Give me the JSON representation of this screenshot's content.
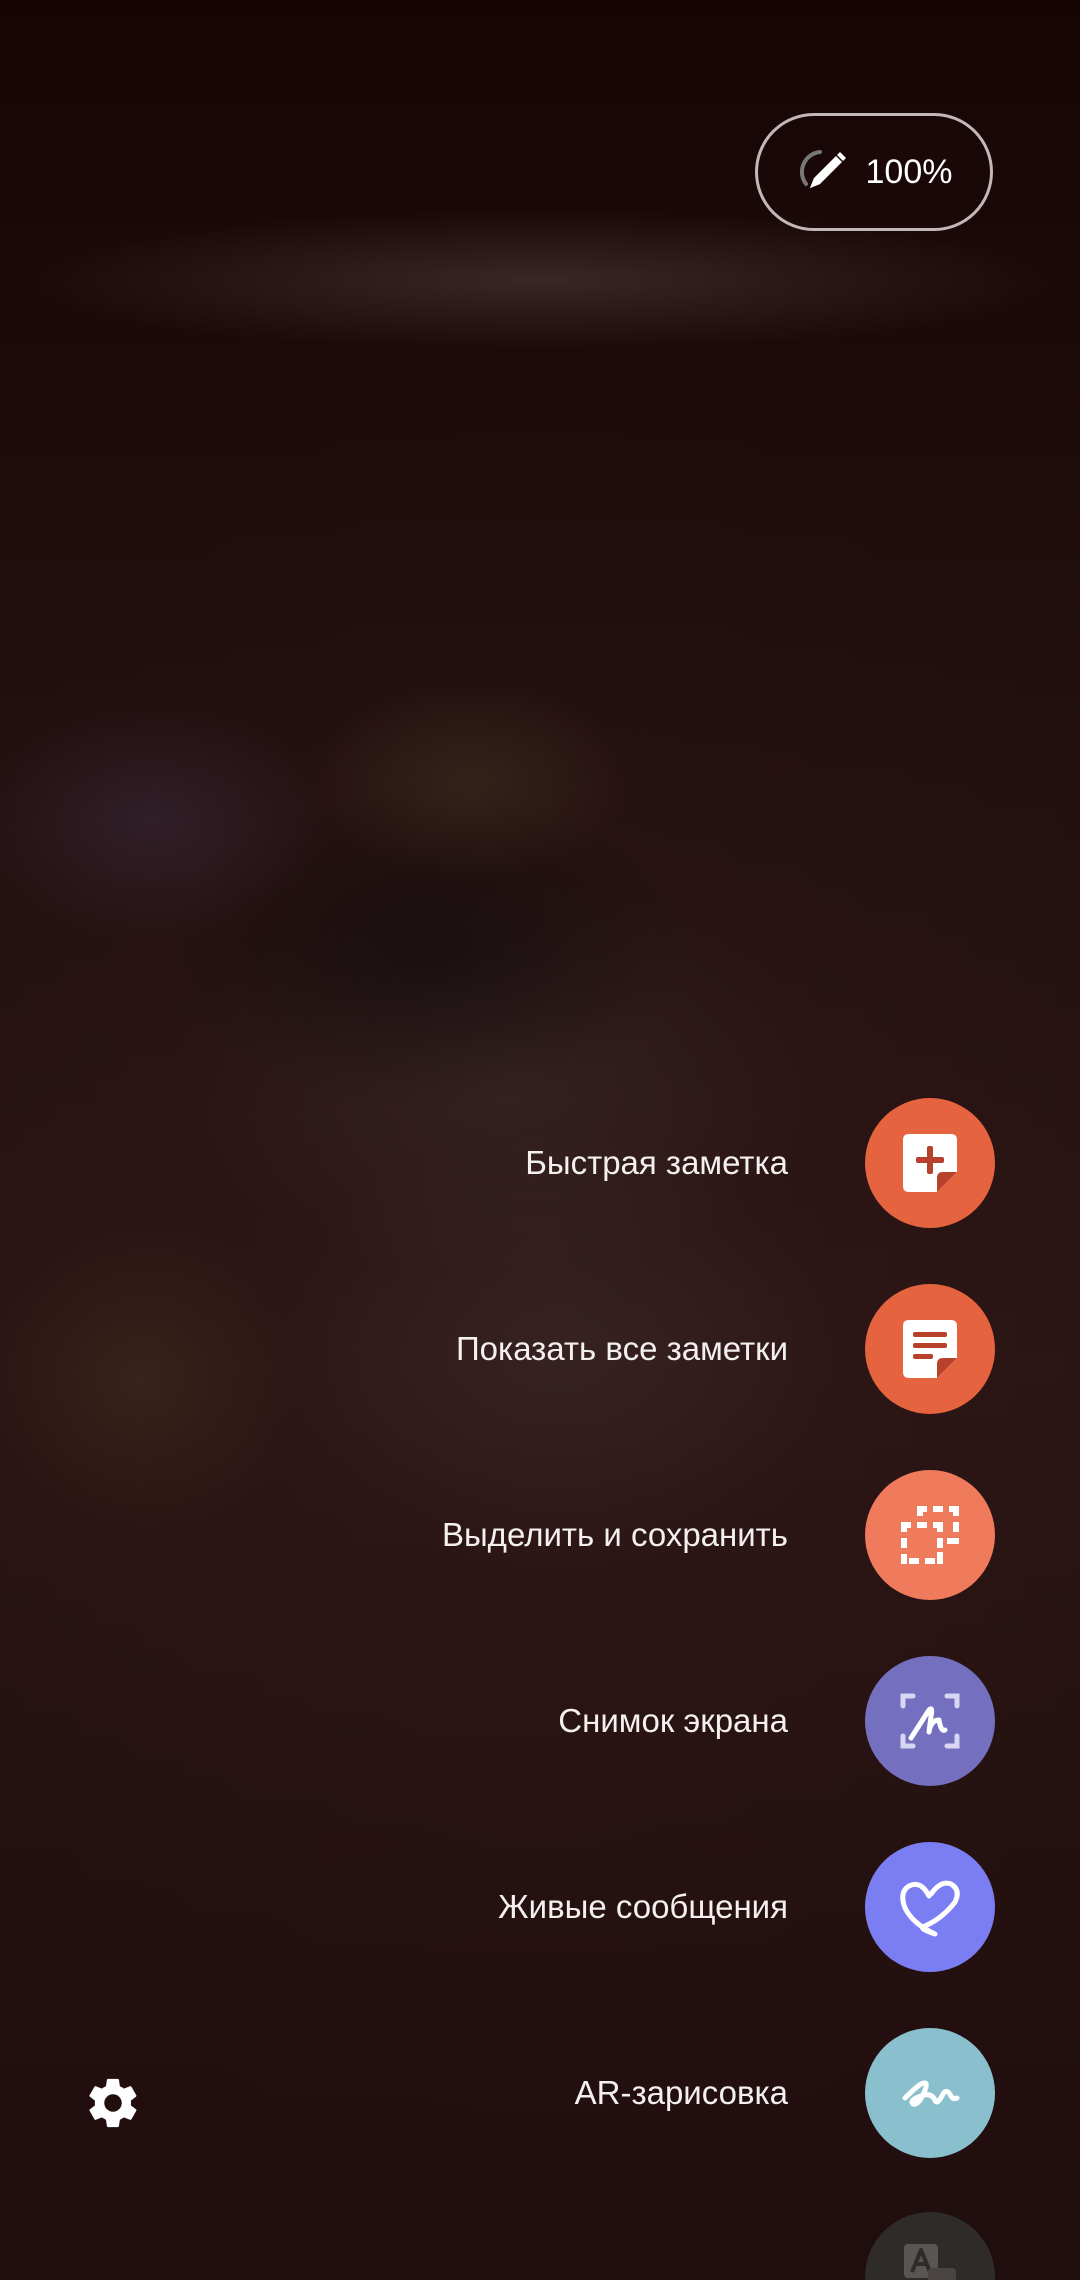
{
  "battery": {
    "icon": "pen-battery-icon",
    "percent_label": "100%"
  },
  "menu": {
    "items": [
      {
        "label": "Быстрая заметка",
        "icon": "sticky-note-plus-icon",
        "color": "#e5633e"
      },
      {
        "label": "Показать все заметки",
        "icon": "notes-list-icon",
        "color": "#e5633e"
      },
      {
        "label": "Выделить и сохранить",
        "icon": "smart-select-icon",
        "color": "#f07a5c"
      },
      {
        "label": "Снимок экрана",
        "icon": "screen-write-icon",
        "color": "#7470bf"
      },
      {
        "label": "Живые сообщения",
        "icon": "heart-scribble-icon",
        "color": "#7b7df3"
      },
      {
        "label": "AR-зарисовка",
        "icon": "ar-doodle-icon",
        "color": "#8abfce"
      }
    ],
    "partial_item": {
      "icon": "translate-icon",
      "color": "#2f2b2b"
    }
  },
  "settings": {
    "icon": "gear-icon"
  }
}
